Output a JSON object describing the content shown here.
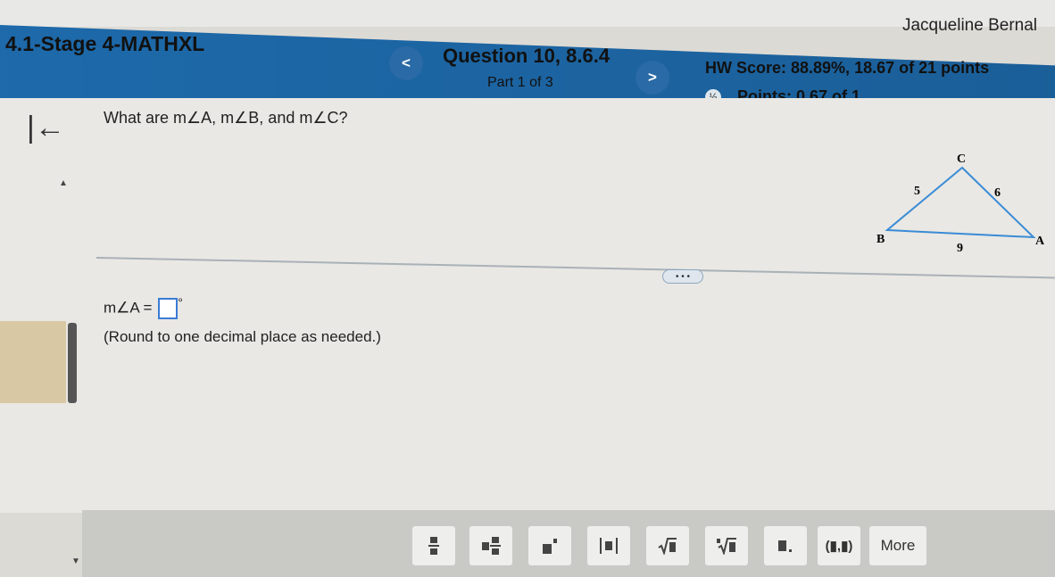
{
  "user": {
    "name": "Jacqueline Bernal"
  },
  "header": {
    "assignment_title": "4.1-Stage 4-MATHXL",
    "prev_label": "<",
    "next_label": ">",
    "question_title": "Question 10, 8.6.4",
    "part": "Part 1 of 3",
    "hw_score": "HW Score: 88.89%, 18.67 of 21 points",
    "points": "Points: 0.67 of 1",
    "points_icon": "partial-credit-icon"
  },
  "content": {
    "back_icon": "back-arrow-icon",
    "question": "What are m∠A, m∠B, and m∠C?",
    "more_dots": "• • •",
    "answer_prefix": "m∠A =",
    "degree": "°",
    "instruction": "(Round to one decimal place as needed.)",
    "triangle": {
      "vertices": [
        "C",
        "B",
        "A"
      ],
      "side_labels": [
        "5",
        "6",
        "9"
      ],
      "color": "#3a8bd6"
    }
  },
  "toolbar": {
    "tools": [
      "fraction",
      "mixed-number",
      "exponent",
      "absolute-value",
      "square-root",
      "nth-root",
      "decimal",
      "ordered-pair"
    ],
    "pair_label": "(▮,▮)",
    "more_label": "More"
  }
}
